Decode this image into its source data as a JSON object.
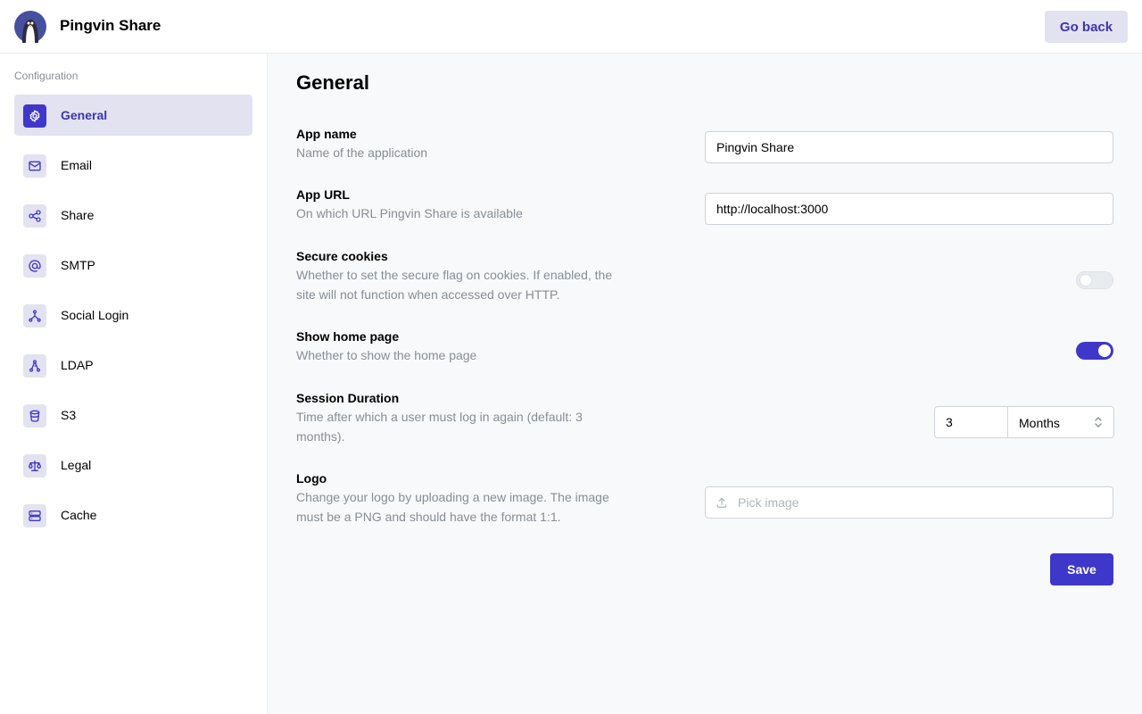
{
  "header": {
    "app_title": "Pingvin Share",
    "go_back_label": "Go back"
  },
  "sidebar": {
    "heading": "Configuration",
    "items": [
      {
        "label": "General",
        "icon": "gear-icon",
        "active": true
      },
      {
        "label": "Email",
        "icon": "mail-icon"
      },
      {
        "label": "Share",
        "icon": "share-icon"
      },
      {
        "label": "SMTP",
        "icon": "at-icon"
      },
      {
        "label": "Social Login",
        "icon": "social-icon"
      },
      {
        "label": "LDAP",
        "icon": "ldap-icon"
      },
      {
        "label": "S3",
        "icon": "bucket-icon"
      },
      {
        "label": "Legal",
        "icon": "scale-icon"
      },
      {
        "label": "Cache",
        "icon": "server-icon"
      }
    ]
  },
  "main": {
    "title": "General",
    "settings": {
      "app_name": {
        "title": "App name",
        "desc": "Name of the application",
        "value": "Pingvin Share"
      },
      "app_url": {
        "title": "App URL",
        "desc": "On which URL Pingvin Share is available",
        "value": "http://localhost:3000"
      },
      "secure_cookies": {
        "title": "Secure cookies",
        "desc": "Whether to set the secure flag on cookies. If enabled, the site will not function when accessed over HTTP.",
        "enabled": false
      },
      "show_home": {
        "title": "Show home page",
        "desc": "Whether to show the home page",
        "enabled": true
      },
      "session": {
        "title": "Session Duration",
        "desc": "Time after which a user must log in again (default: 3 months).",
        "value": "3",
        "unit": "Months"
      },
      "logo": {
        "title": "Logo",
        "desc": "Change your logo by uploading a new image. The image must be a PNG and should have the format 1:1.",
        "placeholder": "Pick image"
      }
    },
    "save_label": "Save"
  },
  "colors": {
    "accent": "#3f37c9",
    "accent_light": "#e3e2f1",
    "muted": "#868e96"
  }
}
